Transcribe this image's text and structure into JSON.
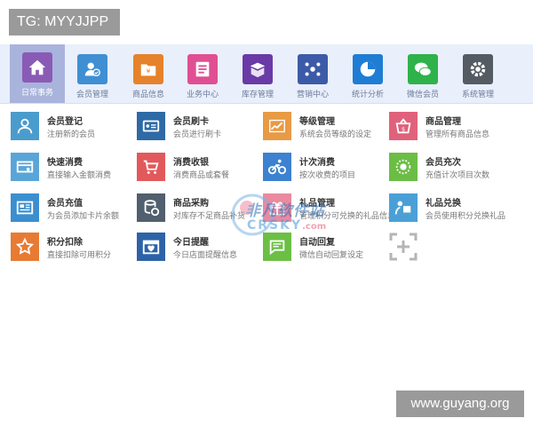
{
  "tag": "TG: MYYJJPP",
  "footer_url": "www.guyang.org",
  "watermark": {
    "cn": "非凡软件站",
    "en": "CRSKY",
    "suffix": ".com"
  },
  "nav": [
    {
      "label": "日常事务",
      "icon": "home-icon",
      "color": "#8a5bb6"
    },
    {
      "label": "会员管理",
      "icon": "member-icon",
      "color": "#3f8fd2"
    },
    {
      "label": "商品信息",
      "icon": "product-icon",
      "color": "#e5822b"
    },
    {
      "label": "业务中心",
      "icon": "business-icon",
      "color": "#e04f93"
    },
    {
      "label": "库存管理",
      "icon": "stock-icon",
      "color": "#6a3aa6"
    },
    {
      "label": "营销中心",
      "icon": "marketing-icon",
      "color": "#3c5aa8"
    },
    {
      "label": "统计分析",
      "icon": "stats-icon",
      "color": "#1f7dd4"
    },
    {
      "label": "微信会员",
      "icon": "wechat-icon",
      "color": "#2fb24a"
    },
    {
      "label": "系统管理",
      "icon": "settings-icon",
      "color": "#555b63"
    }
  ],
  "tiles": [
    {
      "title": "会员登记",
      "desc": "注册新的会员",
      "icon": "user-icon",
      "color": "#4a9ccd"
    },
    {
      "title": "会员刷卡",
      "desc": "会员进行刷卡",
      "icon": "card-icon",
      "color": "#2e6aa6"
    },
    {
      "title": "等级管理",
      "desc": "系统会员等级的设定",
      "icon": "level-icon",
      "color": "#e99a45"
    },
    {
      "title": "商品管理",
      "desc": "管理所有商品信息",
      "icon": "shop-icon",
      "color": "#e0617a"
    },
    {
      "title": "快速消费",
      "desc": "直接输入金额消费",
      "icon": "quick-pay-icon",
      "color": "#5aa5d8"
    },
    {
      "title": "消费收银",
      "desc": "消费商品或套餐",
      "icon": "cart-icon",
      "color": "#e2595b"
    },
    {
      "title": "计次消费",
      "desc": "按次收费的项目",
      "icon": "cycle-icon",
      "color": "#3c82d0"
    },
    {
      "title": "会员充次",
      "desc": "充值计次项目次数",
      "icon": "recharge-count-icon",
      "color": "#6bbd45"
    },
    {
      "title": "会员充值",
      "desc": "为会员添加卡片余额",
      "icon": "recharge-icon",
      "color": "#3b8fcf"
    },
    {
      "title": "商品采购",
      "desc": "对库存不足商品补货",
      "icon": "purchase-icon",
      "color": "#515f6e"
    },
    {
      "title": "礼品管理",
      "desc": "管理积分可兑换的礼品信息",
      "icon": "gift-icon",
      "color": "#e98aa0"
    },
    {
      "title": "礼品兑换",
      "desc": "会员使用积分兑换礼品",
      "icon": "exchange-icon",
      "color": "#4aa0d6"
    },
    {
      "title": "积分扣除",
      "desc": "直接扣除可用积分",
      "icon": "star-icon",
      "color": "#e77b33"
    },
    {
      "title": "今日提醒",
      "desc": "今日店面提醒信息",
      "icon": "calendar-icon",
      "color": "#2d63a6"
    },
    {
      "title": "自动回复",
      "desc": "微信自动回复设定",
      "icon": "reply-icon",
      "color": "#6cbf45"
    }
  ]
}
